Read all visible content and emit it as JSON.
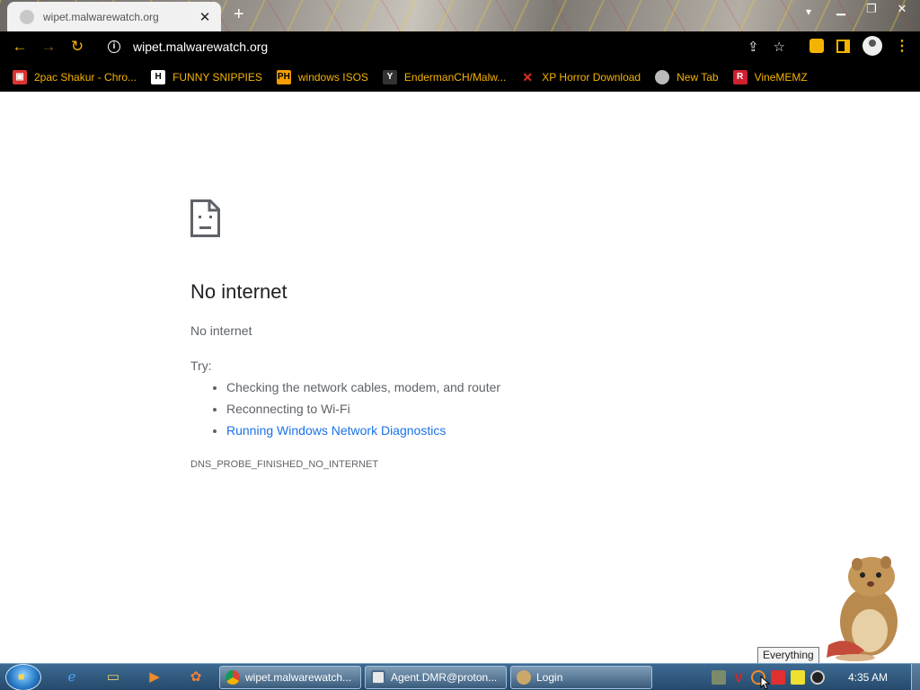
{
  "browser": {
    "tab": {
      "title": "wipet.malwarewatch.org",
      "close": "✕"
    },
    "new_tab": "+",
    "url": "wipet.malwarewatch.org",
    "bookmarks": [
      {
        "label": "2pac Shakur - Chro...",
        "icon": "tv-icon",
        "color": "#e8e8e8"
      },
      {
        "label": "FUNNY SNIPPIES",
        "icon": "h-logo-icon",
        "color": "#ffffff"
      },
      {
        "label": "windows ISOS",
        "icon": "ph-logo-icon",
        "color": "#f59c00"
      },
      {
        "label": "EndermanCH/Malw...",
        "icon": "yp-logo-icon",
        "color": "#333333"
      },
      {
        "label": "XP Horror Download",
        "icon": "x-logo-icon",
        "color": "#e03020"
      },
      {
        "label": "New Tab",
        "icon": "globe-icon",
        "color": "#c0c0c0"
      },
      {
        "label": "VineMEMZ",
        "icon": "r-logo-icon",
        "color": "#d02030"
      }
    ]
  },
  "error_page": {
    "title": "No internet",
    "subtitle": "No internet",
    "try_label": "Try:",
    "suggestions": [
      "Checking the network cables, modem, and router",
      "Reconnecting to Wi-Fi"
    ],
    "diagnostics_link": "Running Windows Network Diagnostics",
    "error_code": "DNS_PROBE_FINISHED_NO_INTERNET"
  },
  "taskbar": {
    "buttons": [
      {
        "label": "wipet.malwarewatch...",
        "icon": "chrome-icon"
      },
      {
        "label": "Agent.DMR@proton...",
        "icon": "window-icon"
      },
      {
        "label": "Login",
        "icon": "user-icon"
      }
    ],
    "clock": "4:35 AM",
    "tooltip": "Everything"
  },
  "colors": {
    "accent": "#f5b301",
    "link": "#1a73e8",
    "text": "#202124",
    "muted": "#5f6368"
  }
}
